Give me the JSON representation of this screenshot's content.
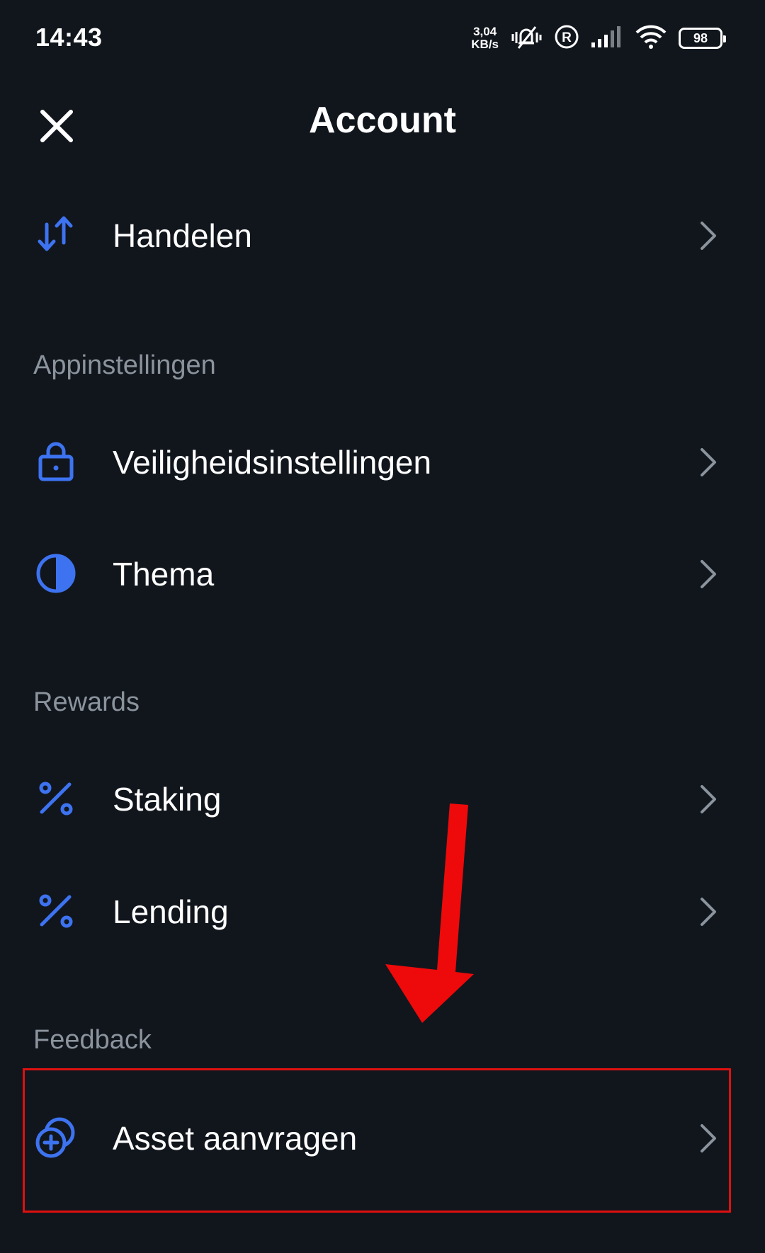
{
  "status_bar": {
    "time": "14:43",
    "net_speed_value": "3,04",
    "net_speed_unit": "KB/s",
    "battery_level": "98",
    "icons": [
      "vibrate-mute-icon",
      "registered-icon",
      "signal-icon",
      "wifi-icon",
      "battery-icon"
    ]
  },
  "header": {
    "title": "Account",
    "close_icon": "close-icon"
  },
  "sections": [
    {
      "label": "",
      "items": [
        {
          "label": "Handelen",
          "icon": "trade-arrows-icon"
        }
      ]
    },
    {
      "label": "Appinstellingen",
      "items": [
        {
          "label": "Veiligheidsinstellingen",
          "icon": "lock-icon"
        },
        {
          "label": "Thema",
          "icon": "theme-contrast-icon"
        }
      ]
    },
    {
      "label": "Rewards",
      "items": [
        {
          "label": "Staking",
          "icon": "percent-icon"
        },
        {
          "label": "Lending",
          "icon": "percent-icon"
        }
      ]
    },
    {
      "label": "Feedback",
      "items": [
        {
          "label": "Asset aanvragen",
          "icon": "add-coins-icon"
        }
      ]
    }
  ],
  "colors": {
    "background": "#11161d",
    "accent": "#3d73f0",
    "text": "#ffffff",
    "section_label": "#8b939c",
    "chevron": "#8b939c",
    "annotation": "#e01010"
  }
}
